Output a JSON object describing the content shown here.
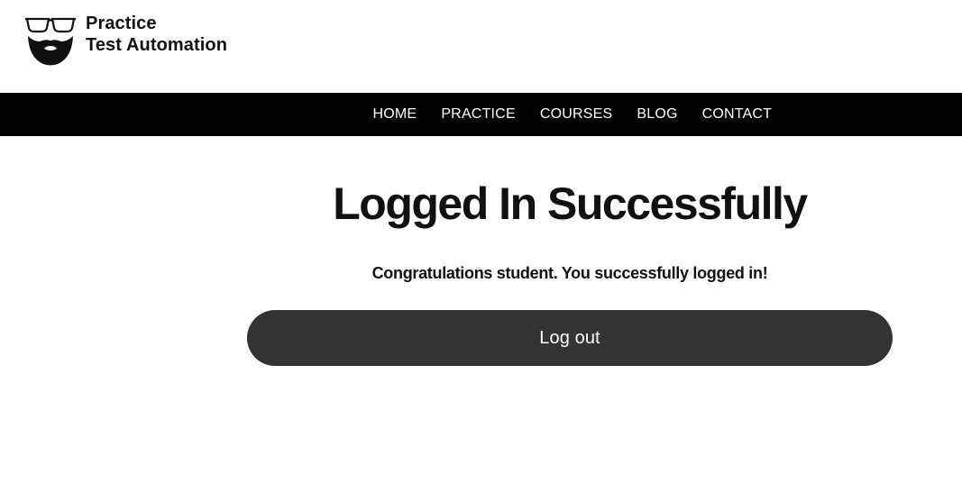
{
  "header": {
    "logo": {
      "icon": "bearded-face-glasses-icon",
      "line1": "Practice",
      "line2": "Test Automation"
    }
  },
  "nav": {
    "items": [
      {
        "label": "HOME"
      },
      {
        "label": "PRACTICE"
      },
      {
        "label": "COURSES"
      },
      {
        "label": "BLOG"
      },
      {
        "label": "CONTACT"
      }
    ]
  },
  "main": {
    "title": "Logged In Successfully",
    "message": "Congratulations student. You successfully logged in!",
    "logout_label": "Log out"
  },
  "colors": {
    "navbar_bg": "#000000",
    "nav_text": "#ffffff",
    "button_bg": "#333333",
    "button_text": "#ffffff",
    "text": "#111111"
  }
}
